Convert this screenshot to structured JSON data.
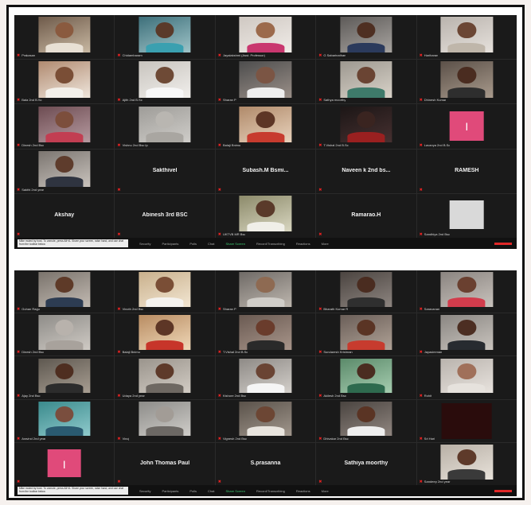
{
  "panels": [
    {
      "tiles": [
        {
          "type": "video",
          "label": "Prakasan",
          "c1": "#6e5a4a",
          "c2": "#c8b8a2",
          "skin": "#8a5a3f",
          "shirt": "#e8e0d4"
        },
        {
          "type": "video",
          "label": "Chidambaram",
          "c1": "#3d6f7a",
          "c2": "#9fc4c8",
          "skin": "#5a3a2a",
          "shirt": "#3aa0b0"
        },
        {
          "type": "video",
          "label": "Jayalakshmi (Asst. Professor)",
          "c1": "#cfc8c2",
          "c2": "#f0ece8",
          "skin": "#9c6a4c",
          "shirt": "#c9376f"
        },
        {
          "type": "video",
          "label": "G Sabarinathan",
          "c1": "#5d5a58",
          "c2": "#a8a4a0",
          "skin": "#4e2f22",
          "shirt": "#2b3a5c"
        },
        {
          "type": "video",
          "label": "Hariharan",
          "c1": "#b9b3ad",
          "c2": "#e6e1dc",
          "skin": "#6b4634",
          "shirt": "#bfb6aa"
        },
        {
          "type": "video",
          "label": "Bala 2nd B.Sc",
          "c1": "#b08a70",
          "c2": "#efe6dc",
          "skin": "#7a4e36",
          "shirt": "#f3f0ea"
        },
        {
          "type": "video",
          "label": "Ajith 2nd B.Sc",
          "c1": "#c8c4be",
          "c2": "#f1efec",
          "skin": "#6e4a36",
          "shirt": "#f7f7f7"
        },
        {
          "type": "video",
          "label": "Sharan P",
          "c1": "#4d4d4d",
          "c2": "#9a8f88",
          "skin": "#7b5544",
          "shirt": "#eeeeee"
        },
        {
          "type": "video",
          "label": "Sathya moorthy",
          "c1": "#9d9890",
          "c2": "#d8d2c8",
          "skin": "#6a4433",
          "shirt": "#3e7a6a"
        },
        {
          "type": "video",
          "label": "Dhinesh Kumar",
          "c1": "#5b5048",
          "c2": "#a89a8c",
          "skin": "#4a2c20",
          "shirt": "#2e2e2e"
        },
        {
          "type": "video",
          "label": "Dinesh 2nd Bsc",
          "c1": "#6d4c52",
          "c2": "#b69aa0",
          "skin": "#7c4e3c",
          "shirt": "#c23e52"
        },
        {
          "type": "video",
          "label": "Vishnu 2nd Bsc Ip",
          "c1": "#9e9c98",
          "c2": "#cfcdc9",
          "skin": "#b9b6b1",
          "shirt": "#a9a6a1"
        },
        {
          "type": "video",
          "label": "Balaji Bnimu",
          "c1": "#b08a6a",
          "c2": "#e8d2bc",
          "skin": "#5d3626",
          "shirt": "#c73b2e"
        },
        {
          "type": "video",
          "label": "T.Vishal 2nd B.Sc",
          "c1": "#1c1616",
          "c2": "#463030",
          "skin": "#3a2420",
          "shirt": "#9a2020"
        },
        {
          "type": "initial",
          "label": "Lavanya 2nd B.Sc",
          "initial": "I"
        },
        {
          "type": "video",
          "label": "Sakthi 2nd year",
          "c1": "#7b7570",
          "c2": "#c9c3bd",
          "skin": "#5e3c2c",
          "shirt": "#2f3440"
        },
        {
          "type": "name",
          "label": "",
          "name": "Sakthivel"
        },
        {
          "type": "name",
          "label": "",
          "name": "Subash.M  Bsmi..."
        },
        {
          "type": "name",
          "label": "",
          "name": "Naveen k 2nd bs..."
        },
        {
          "type": "name",
          "label": "",
          "name": "RAMESH"
        },
        {
          "type": "name",
          "label": "",
          "name": "Akshay"
        },
        {
          "type": "name",
          "label": "",
          "name": "Abinesh 3rd BSC"
        },
        {
          "type": "video",
          "label": "UKTVB MR Bsc",
          "c1": "#8c8a6a",
          "c2": "#d8d6c0",
          "skin": "#5a3a2a",
          "shirt": "#f0efe8"
        },
        {
          "type": "name",
          "label": "",
          "name": "Ramarao.H"
        },
        {
          "type": "blank",
          "label": "Sandhiya 2nd Bsc"
        }
      ],
      "notice": "Mike muted by host. To unmute, press Alt+A. Share your screen, raise hand, and use chat from the toolbar below.",
      "tools": [
        "Security",
        "Participants",
        "Polls",
        "Chat",
        "Share Screen",
        "Record/Transcribing",
        "Reactions",
        "More"
      ]
    },
    {
      "tiles": [
        {
          "type": "video",
          "label": "Guhan Ragu",
          "c1": "#7a736c",
          "c2": "#c2bab2",
          "skin": "#5e3a28",
          "shirt": "#2d3c52"
        },
        {
          "type": "video",
          "label": "Vinoth 2nd Bsc",
          "c1": "#c9b08c",
          "c2": "#f2e6d2",
          "skin": "#7a4e36",
          "shirt": "#f4f2ee"
        },
        {
          "type": "video",
          "label": "Sharan P",
          "c1": "#6f6a66",
          "c2": "#bdb6ae",
          "skin": "#8e6a52",
          "shirt": "#d0cdc8"
        },
        {
          "type": "video",
          "label": "Bharath Kumar R",
          "c1": "#4b4440",
          "c2": "#8d8580",
          "skin": "#4a2c20",
          "shirt": "#2f2f2f"
        },
        {
          "type": "video",
          "label": "Saravanan",
          "c1": "#8a8480",
          "c2": "#c8c2bc",
          "skin": "#6a4030",
          "shirt": "#d23c4c"
        },
        {
          "type": "video",
          "label": "Dinesh 2nd Bsc",
          "c1": "#8e8c88",
          "c2": "#cfcac4",
          "skin": "#b8b2ac",
          "shirt": "#a8a29c"
        },
        {
          "type": "video",
          "label": "Balaji Bnimu",
          "c1": "#b88c62",
          "c2": "#f0d8b8",
          "skin": "#5d3626",
          "shirt": "#c7352a"
        },
        {
          "type": "video",
          "label": "T.Vishal 2nd B.Sc",
          "c1": "#6a5a52",
          "c2": "#a8958a",
          "skin": "#6a3c2c",
          "shirt": "#2a2a2a"
        },
        {
          "type": "video",
          "label": "Sundaresh Krishnan",
          "c1": "#6a5e58",
          "c2": "#b0a296",
          "skin": "#5a3424",
          "shirt": "#c73b2e"
        },
        {
          "type": "video",
          "label": "Jayasimman",
          "c1": "#8a8682",
          "c2": "#c9c4be",
          "skin": "#4c2e22",
          "shirt": "#272b30"
        },
        {
          "type": "video",
          "label": "Ajay 2nd Bsc",
          "c1": "#5e5850",
          "c2": "#a89e92",
          "skin": "#4e2e20",
          "shirt": "#2c2c2c"
        },
        {
          "type": "video",
          "label": "Udaya 2nd year",
          "c1": "#9a948c",
          "c2": "#d2ccc4",
          "skin": "#5e3a2a",
          "shirt": "#6e6862"
        },
        {
          "type": "video",
          "label": "Kishore 2nd Bsc",
          "c1": "#8e8a86",
          "c2": "#d3cfca",
          "skin": "#6a4434",
          "shirt": "#f5f5f5"
        },
        {
          "type": "video",
          "label": "Akilesh 2nd Bsc",
          "c1": "#5b8a6a",
          "c2": "#a6cdb0",
          "skin": "#4a2c20",
          "shirt": "#2e6a4e"
        },
        {
          "type": "video",
          "label": "Rohit",
          "c1": "#b9b3ad",
          "c2": "#e8e3de",
          "skin": "#a0705a",
          "shirt": "#e6e2dd"
        },
        {
          "type": "video",
          "label": "Aravind 2nd year",
          "c1": "#3a8a8c",
          "c2": "#8fcacc",
          "skin": "#7a4e3e",
          "shirt": "#2a5a70"
        },
        {
          "type": "video",
          "label": "Vinoj",
          "c1": "#8d8c89",
          "c2": "#cfcdc9",
          "skin": "#a29c96",
          "shirt": "#6c6864"
        },
        {
          "type": "video",
          "label": "Vignesh 2nd Bsc",
          "c1": "#5a524a",
          "c2": "#a0968c",
          "skin": "#6c4634",
          "shirt": "#e8e4de"
        },
        {
          "type": "video",
          "label": "Dhivakar 2nd Bsc",
          "c1": "#4a4440",
          "c2": "#908680",
          "skin": "#5a3424",
          "shirt": "#eeeeee"
        },
        {
          "type": "dark",
          "label": "Sri Hari"
        },
        {
          "type": "initial",
          "label": "",
          "initial": "I"
        },
        {
          "type": "name",
          "label": "",
          "name": "John Thomas Paul"
        },
        {
          "type": "name",
          "label": "",
          "name": "S.prasanna"
        },
        {
          "type": "name",
          "label": "",
          "name": "Sathiya  moorthy"
        },
        {
          "type": "video",
          "label": "Sandeep 2nd year",
          "c1": "#b8b0a6",
          "c2": "#e8e2da",
          "skin": "#5e3a2a",
          "shirt": "#3a3a3a"
        }
      ],
      "notice": "Mike muted by host. To unmute, press Alt+A. Share your screen, raise hand, and use chat from the toolbar below.",
      "tools": [
        "Security",
        "Participants",
        "Polls",
        "Chat",
        "Share Screen",
        "Record/Transcribing",
        "Reactions",
        "More"
      ]
    }
  ],
  "colors": {
    "accent_green": "#3cc46e",
    "mute_red": "#e22222",
    "tile_bg": "#1a1a1a"
  }
}
